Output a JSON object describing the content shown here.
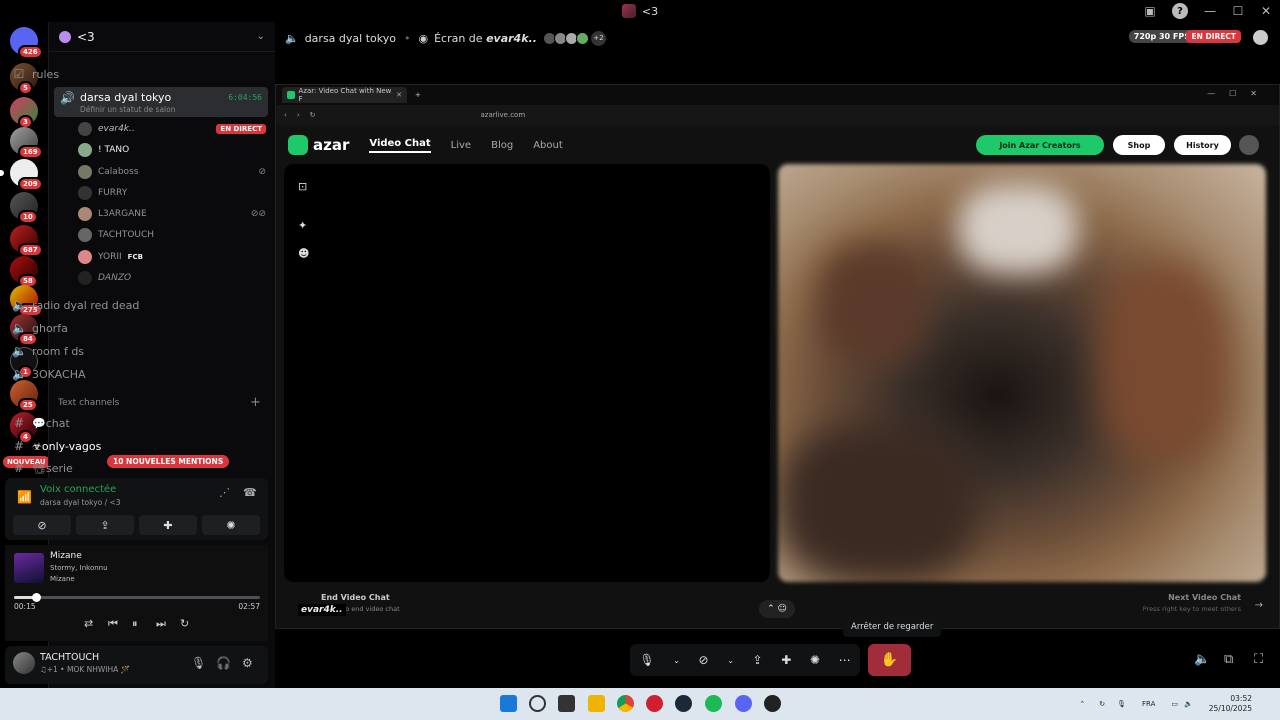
{
  "titlebar": {
    "title": "<3"
  },
  "rail": {
    "counts": [
      "426",
      "5",
      "3",
      "169",
      "209",
      "10",
      "687",
      "58",
      "275",
      "84",
      "1",
      "25",
      "4"
    ],
    "nouveau": "NOUVEAU"
  },
  "server": {
    "name": "<3"
  },
  "channels": {
    "rules": "rules",
    "active": {
      "name": "darsa dyal tokyo",
      "time": "6:04:56",
      "status": "Définir un statut de salon"
    },
    "users": [
      {
        "name": "evar4k..",
        "badge": "EN DIRECT"
      },
      {
        "name": "! TANO"
      },
      {
        "name": "Calaboss"
      },
      {
        "name": "FURRY"
      },
      {
        "name": "L3ARGANE"
      },
      {
        "name": "TACHTOUCH"
      },
      {
        "name": "YORII",
        "tag": "FCB"
      },
      {
        "name": "DANZO"
      }
    ],
    "voice": [
      "radio dyal red dead",
      "ghorfa",
      "room f ds",
      "3OKACHA"
    ],
    "text_section": "Text channels",
    "text": [
      "💬chat",
      "☣only-vagos",
      "📽serie"
    ],
    "mentions": "10 NOUVELLES MENTIONS"
  },
  "voice_panel": {
    "status": "Voix connectée",
    "location": "darsa dyal tokyo / <3"
  },
  "music": {
    "title": "Mizane",
    "artist": "Stormy, Inkonnu",
    "album": "Mizane",
    "current": "00:15",
    "duration": "02:57",
    "progress": 0.09
  },
  "user": {
    "name": "TACHTOUCH",
    "status": "♫+1 • MOK NHWIHA 🪄"
  },
  "stream": {
    "channel": "darsa dyal tokyo",
    "screen_of": "Écran de",
    "streamer": "evar4k..",
    "extra": "+2",
    "quality": "720p 30 FPS",
    "live": "EN DIRECT"
  },
  "browser": {
    "tab_title": "Azar: Video Chat with New F",
    "url": "azarlive.com",
    "logo": "azar",
    "nav": [
      "Video Chat",
      "Live",
      "Blog",
      "About"
    ],
    "join": "Join Azar Creators",
    "shop": "Shop",
    "history": "History",
    "end_chat": "End Video Chat",
    "end_hint": "... key to end video chat",
    "next_chat": "Next Video Chat",
    "next_hint": "Press right key to meet others",
    "overlay_name": "evar4k.."
  },
  "tooltip": "Arrêter de regarder",
  "taskbar": {
    "lang": "FRA",
    "time": "03:52",
    "date": "25/10/2025"
  }
}
